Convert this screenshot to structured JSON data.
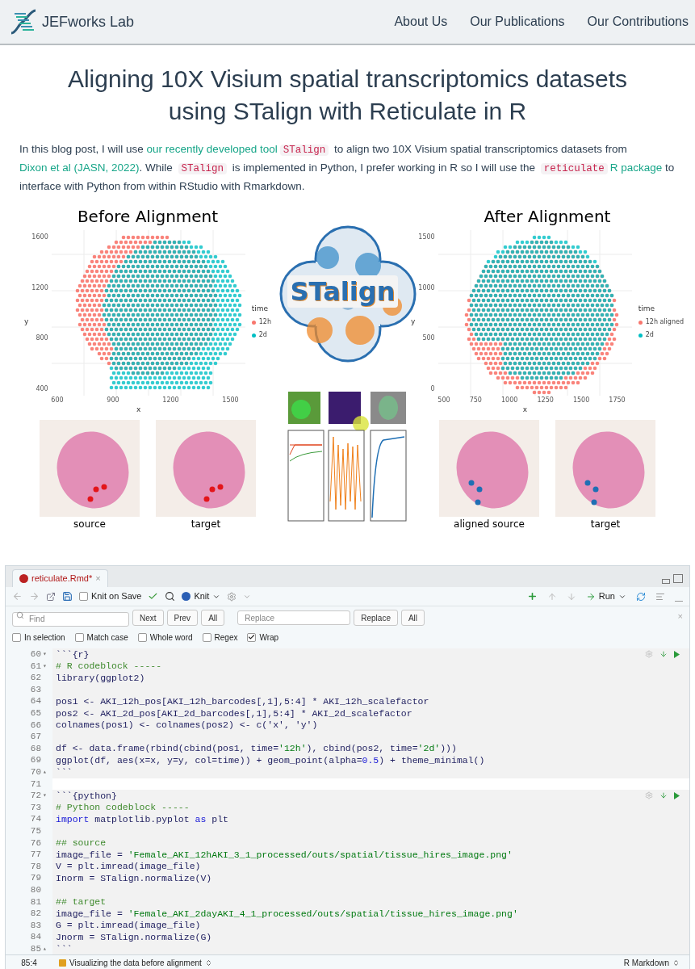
{
  "nav": {
    "brand": "JEFworks Lab",
    "links": [
      "About Us",
      "Our Publications",
      "Our Contributions"
    ]
  },
  "title": "Aligning 10X Visium spatial transcriptomics datasets using STalign with Reticulate in R",
  "intro": [
    {
      "text": "In this blog post, I will use ",
      "kind": "text"
    },
    {
      "text": "our recently developed tool",
      "kind": "link"
    },
    {
      "text": "STalign",
      "kind": "code"
    },
    {
      "text": " to align two 10X Visium spatial transcriptomics datasets from ",
      "kind": "text"
    },
    {
      "text": "Dixon et al (JASN, 2022)",
      "kind": "link"
    },
    {
      "text": ". While ",
      "kind": "text"
    },
    {
      "text": "STalign",
      "kind": "code"
    },
    {
      "text": " is implemented in Python, I prefer working in R so I will use the ",
      "kind": "text"
    },
    {
      "text": "reticulate",
      "kind": "code"
    },
    {
      "text": "R package",
      "kind": "link"
    },
    {
      "text": " to interface with Python from within RStudio with Rmarkdown.",
      "kind": "text"
    }
  ],
  "figure": {
    "logo_text": "STalign",
    "panels": [
      {
        "title": "Before Alignment",
        "plot": {
          "kind": "before",
          "y_label": "y",
          "x_label": "x",
          "y_ticks": [
            "1600",
            "1200",
            "800",
            "400"
          ],
          "x_ticks": [
            "600",
            "900",
            "1200",
            "1500"
          ],
          "legend_title": "time",
          "legend": [
            {
              "label": "12h",
              "color": "#f8766d"
            },
            {
              "label": "2d",
              "color": "#00bfc4"
            }
          ]
        },
        "images": [
          {
            "caption": "source",
            "color": "#e3151a"
          },
          {
            "caption": "target",
            "color": "#e3151a"
          }
        ]
      },
      {
        "title": "After Alignment",
        "plot": {
          "kind": "after",
          "y_label": "y",
          "x_label": "x",
          "y_ticks": [
            "1500",
            "1000",
            "500",
            "0"
          ],
          "x_ticks": [
            "500",
            "750",
            "1000",
            "1250",
            "1500",
            "1750"
          ],
          "legend_title": "time",
          "legend": [
            {
              "label": "12h aligned",
              "color": "#f8766d"
            },
            {
              "label": "2d",
              "color": "#00bfc4"
            }
          ]
        },
        "images": [
          {
            "caption": "aligned source",
            "color": "#1f6fb4"
          },
          {
            "caption": "target",
            "color": "#1f6fb4"
          }
        ]
      }
    ]
  },
  "editor": {
    "tab": {
      "label": "reticulate.Rmd*",
      "close": "×"
    },
    "toolbar": {
      "knit_on_save": {
        "label": "Knit on Save",
        "checked": false
      },
      "knit": "Knit",
      "run": "Run"
    },
    "find": {
      "placeholder": "Find",
      "buttons": [
        "Next",
        "Prev",
        "All"
      ],
      "replace_placeholder": "Replace",
      "replace_buttons": [
        "Replace",
        "All"
      ],
      "close": "×"
    },
    "options": [
      {
        "label": "In selection",
        "checked": false
      },
      {
        "label": "Match case",
        "checked": false
      },
      {
        "label": "Whole word",
        "checked": false
      },
      {
        "label": "Regex",
        "checked": false
      },
      {
        "label": "Wrap",
        "checked": true
      }
    ],
    "lines": [
      {
        "n": "60",
        "fold": "▾",
        "kind": "header",
        "parts": [
          {
            "text": "```{r}",
            "kind": "plain"
          }
        ]
      },
      {
        "n": "61",
        "fold": "▾",
        "kind": "code",
        "parts": [
          {
            "text": "# R codeblock -----",
            "kind": "comment"
          }
        ]
      },
      {
        "n": "62",
        "kind": "code",
        "parts": [
          {
            "text": "library(ggplot2)",
            "kind": "plain"
          }
        ]
      },
      {
        "n": "63",
        "kind": "code"
      },
      {
        "n": "64",
        "kind": "code",
        "parts": [
          {
            "text": "pos1 <- AKI_12h_pos[AKI_12h_barcodes[,1],5:4] * AKI_12h_scalefactor",
            "kind": "plain"
          }
        ]
      },
      {
        "n": "65",
        "kind": "code",
        "parts": [
          {
            "text": "pos2 <- AKI_2d_pos[AKI_2d_barcodes[,1],5:4] * AKI_2d_scalefactor",
            "kind": "plain"
          }
        ]
      },
      {
        "n": "66",
        "kind": "code",
        "parts": [
          {
            "text": "colnames(pos1) <- colnames(pos2) <- c('x', 'y')",
            "kind": "plain"
          }
        ]
      },
      {
        "n": "67",
        "kind": "code"
      },
      {
        "n": "68",
        "kind": "code",
        "parts": [
          {
            "text": "df <- data.frame(rbind(cbind(pos1, time=",
            "kind": "plain"
          },
          {
            "text": "'12h'",
            "kind": "string"
          },
          {
            "text": "), cbind(pos2, time=",
            "kind": "plain"
          },
          {
            "text": "'2d'",
            "kind": "string"
          },
          {
            "text": ")))",
            "kind": "plain"
          }
        ]
      },
      {
        "n": "69",
        "kind": "code",
        "parts": [
          {
            "text": "ggplot(df, aes(x=x, y=y, col=time)) + geom_point(alpha=",
            "kind": "plain"
          },
          {
            "text": "0.5",
            "kind": "number"
          },
          {
            "text": ") + theme_minimal()",
            "kind": "plain"
          }
        ]
      },
      {
        "n": "70",
        "fold": "▴",
        "kind": "code",
        "parts": [
          {
            "text": "```",
            "kind": "plain"
          }
        ]
      },
      {
        "n": "71",
        "kind": "outside"
      },
      {
        "n": "72",
        "fold": "▾",
        "kind": "header",
        "parts": [
          {
            "text": "```{python}",
            "kind": "plain"
          }
        ]
      },
      {
        "n": "73",
        "kind": "code",
        "parts": [
          {
            "text": "# Python codeblock -----",
            "kind": "comment"
          }
        ]
      },
      {
        "n": "74",
        "kind": "code",
        "parts": [
          {
            "text": "import",
            "kind": "keyword"
          },
          {
            "text": " matplotlib.pyplot ",
            "kind": "plain"
          },
          {
            "text": "as",
            "kind": "keyword"
          },
          {
            "text": " plt",
            "kind": "plain"
          }
        ]
      },
      {
        "n": "75",
        "kind": "code"
      },
      {
        "n": "76",
        "kind": "code",
        "parts": [
          {
            "text": "## source",
            "kind": "comment"
          }
        ]
      },
      {
        "n": "77",
        "kind": "code",
        "parts": [
          {
            "text": "image_file = ",
            "kind": "plain"
          },
          {
            "text": "'Female_AKI_12hAKI_3_1_processed/outs/spatial/tissue_hires_image.png'",
            "kind": "string"
          }
        ]
      },
      {
        "n": "78",
        "kind": "code",
        "parts": [
          {
            "text": "V = plt.imread(image_file)",
            "kind": "plain"
          }
        ]
      },
      {
        "n": "79",
        "kind": "code",
        "parts": [
          {
            "text": "Inorm = STalign.normalize(V)",
            "kind": "plain"
          }
        ]
      },
      {
        "n": "80",
        "kind": "code"
      },
      {
        "n": "81",
        "kind": "code",
        "parts": [
          {
            "text": "## target",
            "kind": "comment"
          }
        ]
      },
      {
        "n": "82",
        "kind": "code",
        "parts": [
          {
            "text": "image_file = ",
            "kind": "plain"
          },
          {
            "text": "'Female_AKI_2dayAKI_4_1_processed/outs/spatial/tissue_hires_image.png'",
            "kind": "string"
          }
        ]
      },
      {
        "n": "83",
        "kind": "code",
        "parts": [
          {
            "text": "G = plt.imread(image_file)",
            "kind": "plain"
          }
        ]
      },
      {
        "n": "84",
        "kind": "code",
        "parts": [
          {
            "text": "Jnorm = STalign.normalize(G)",
            "kind": "plain"
          }
        ]
      },
      {
        "n": "85",
        "fold": "▴",
        "kind": "code",
        "parts": [
          {
            "text": "```",
            "kind": "plain"
          }
        ]
      }
    ],
    "status": {
      "position": "85:4",
      "section": "Visualizing the data before alignment",
      "mode": "R Markdown"
    }
  }
}
